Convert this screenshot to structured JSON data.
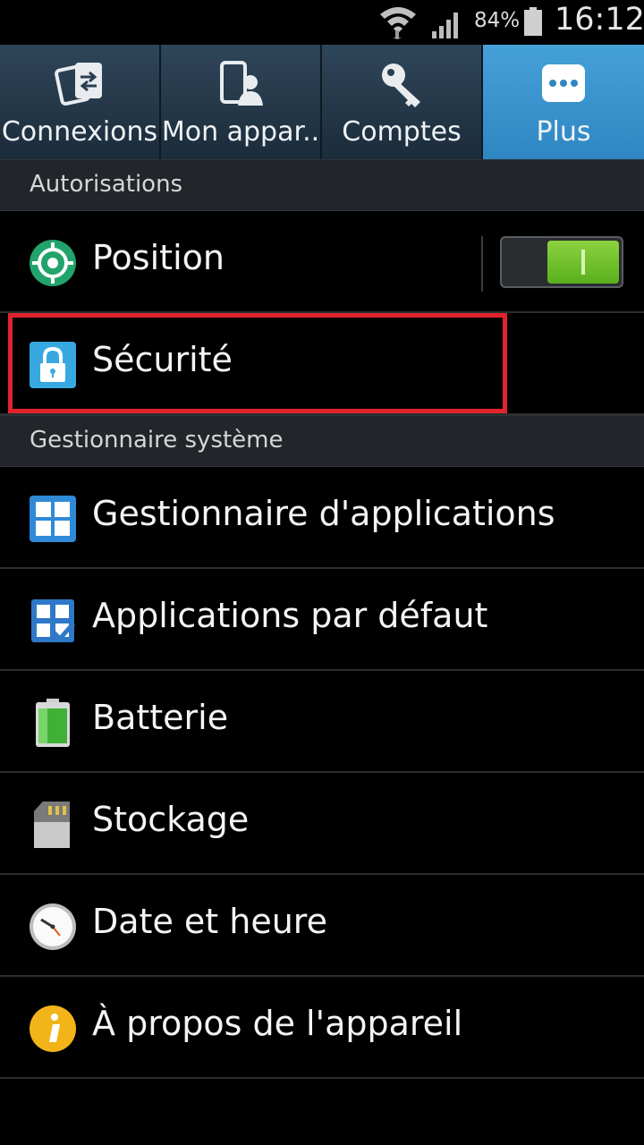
{
  "status_bar": {
    "battery_percent": "84%",
    "time": "16:12"
  },
  "tabs": [
    {
      "label": "Connexions",
      "icon": "connections-icon",
      "active": false
    },
    {
      "label": "Mon appar..",
      "icon": "my-device-icon",
      "active": false
    },
    {
      "label": "Comptes",
      "icon": "accounts-key-icon",
      "active": false
    },
    {
      "label": "Plus",
      "icon": "more-dots-icon",
      "active": true
    }
  ],
  "sections": {
    "permissions": {
      "title": "Autorisations"
    },
    "system": {
      "title": "Gestionnaire système"
    }
  },
  "rows": {
    "position": {
      "label": "Position",
      "icon": "location-icon",
      "toggle_on": true
    },
    "security": {
      "label": "Sécurité",
      "icon": "lock-icon",
      "highlighted": true
    },
    "app_manager": {
      "label": "Gestionnaire d'applications",
      "icon": "app-grid-icon"
    },
    "default_apps": {
      "label": "Applications par défaut",
      "icon": "default-apps-icon"
    },
    "battery": {
      "label": "Batterie",
      "icon": "battery-icon"
    },
    "storage": {
      "label": "Stockage",
      "icon": "sd-card-icon"
    },
    "date_time": {
      "label": "Date et heure",
      "icon": "clock-icon"
    },
    "about": {
      "label": "À propos de l'appareil",
      "icon": "info-icon"
    }
  },
  "colors": {
    "highlight": "#e1232d",
    "active_tab": "#3a94cf",
    "toggle_on": "#6cc02a"
  }
}
